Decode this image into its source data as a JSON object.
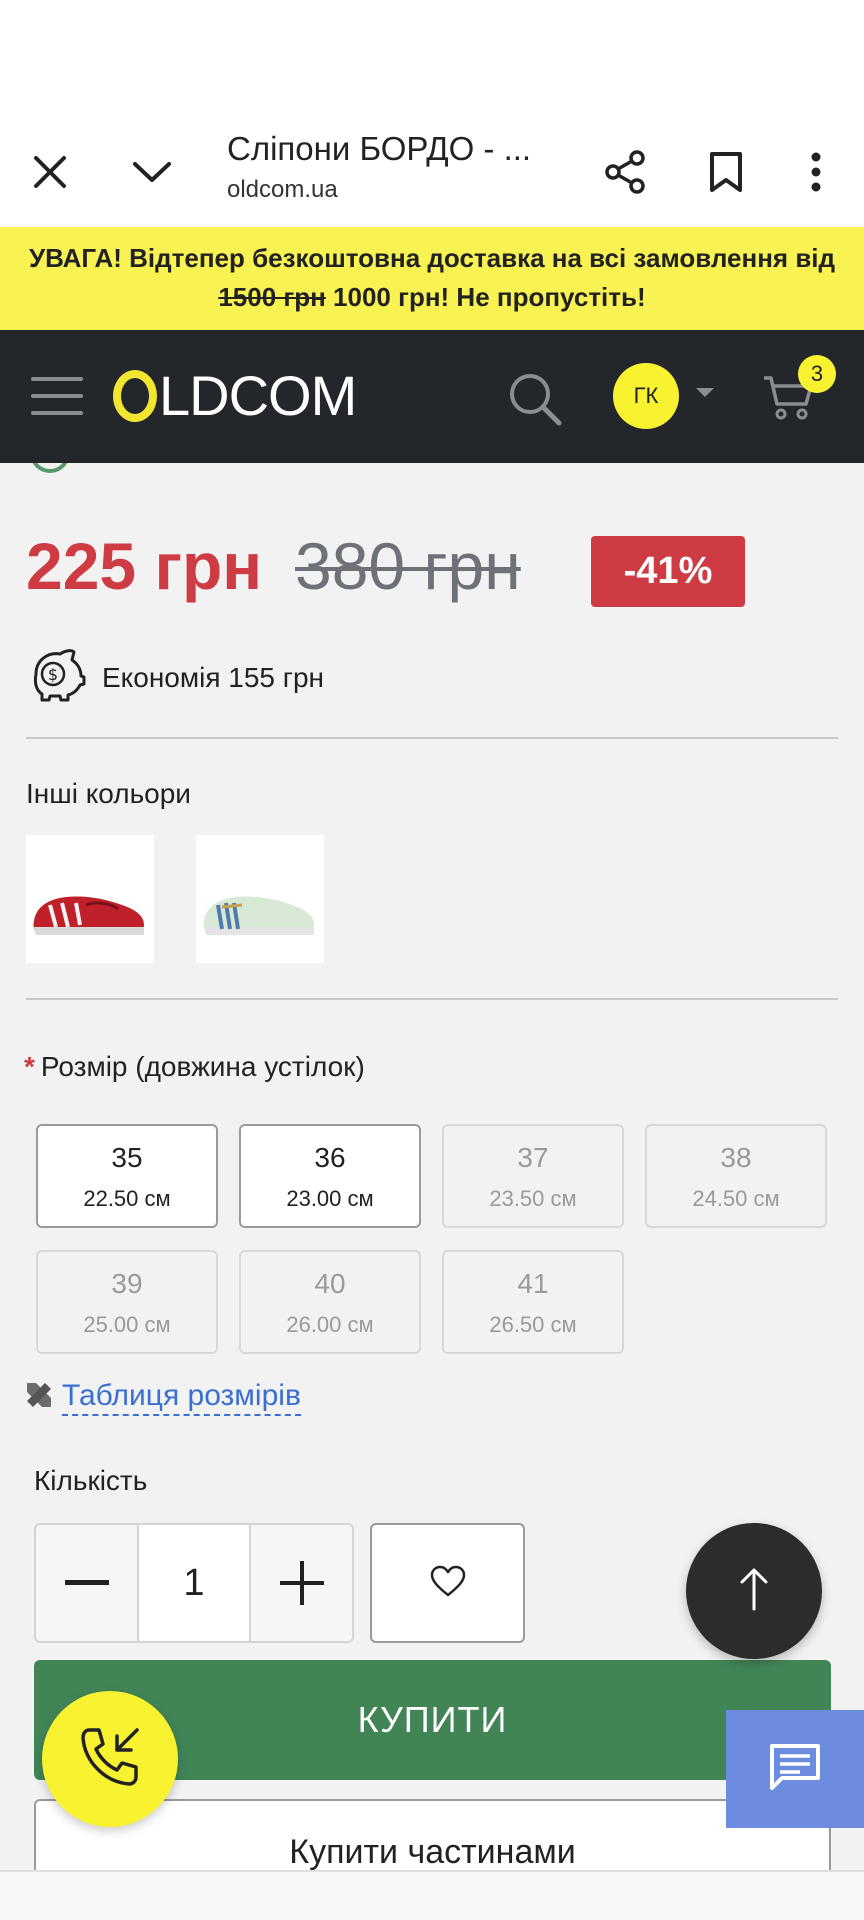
{
  "browser": {
    "page_title": "Сліпони БОРДО - ...",
    "url": "oldcom.ua",
    "close_icon": "close-icon",
    "collapse_icon": "chevron-down-icon",
    "share_icon": "share-icon",
    "bookmark_icon": "bookmark-icon",
    "menu_icon": "more-vert-icon"
  },
  "promo": {
    "text_before": "УВАГА! Відтепер безкоштовна доставка на всі замовлення від ",
    "old_threshold": "1500 грн",
    "text_after": " 1000 грн! Не пропустіть!",
    "background": "#f8f252"
  },
  "header": {
    "logo_text": "LDCOM",
    "avatar_initials": "ГК",
    "cart_count": "3",
    "accent": "#f8f231",
    "background": "#23262b"
  },
  "product": {
    "price": "225 грн",
    "old_price": "380 грн",
    "discount": "-41%",
    "saving": "Економія 155 грн",
    "price_color": "#cf3b43",
    "other_colors_label": "Інші кольори",
    "size_label": "Розмір (довжина устілок)",
    "required_mark": "*",
    "sizes": [
      {
        "size": "35",
        "length": "22.50 см",
        "available": true
      },
      {
        "size": "36",
        "length": "23.00 см",
        "available": true
      },
      {
        "size": "37",
        "length": "23.50 см",
        "available": false
      },
      {
        "size": "38",
        "length": "24.50 см",
        "available": false
      },
      {
        "size": "39",
        "length": "25.00 см",
        "available": false
      },
      {
        "size": "40",
        "length": "26.00 см",
        "available": false
      },
      {
        "size": "41",
        "length": "26.50 см",
        "available": false
      }
    ],
    "size_table_link": "Таблиця розмірів",
    "quantity_label": "Кількість",
    "quantity": "1",
    "buy_label": "КУПИТИ",
    "buy_color": "#418557",
    "installments_label": "Купити частинами"
  }
}
